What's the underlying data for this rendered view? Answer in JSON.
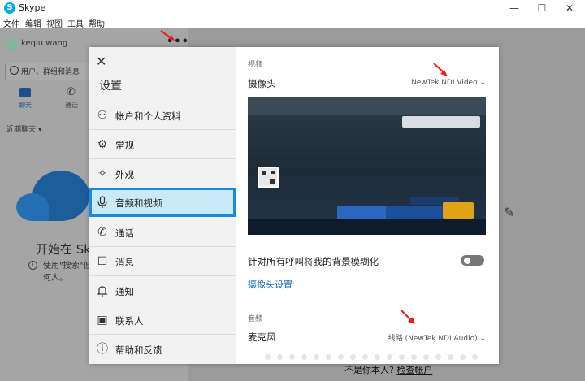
{
  "titlebar": {
    "app_name": "Skype",
    "logo_letter": "S",
    "minimize": "—",
    "maximize": "☐",
    "close": "✕"
  },
  "menubar": {
    "items": [
      "文件",
      "编辑",
      "视图",
      "工具",
      "帮助"
    ]
  },
  "sidebar": {
    "user_name": "keqiu wang",
    "more": "•••",
    "search_placeholder": "用户、群组和消息",
    "tabs": [
      {
        "label": "聊天"
      },
      {
        "label": "通话"
      }
    ],
    "recent_chats": "近期聊天 ▾",
    "start_text": "开始在 Sk",
    "hint_text": "使用\"搜索\"但 何人。"
  },
  "settings": {
    "title": "设置",
    "close": "✕",
    "nav_items": [
      {
        "label": "帐户和个人资料",
        "icon": "person-icon",
        "glyph": "⚇"
      },
      {
        "label": "常规",
        "icon": "gear-icon",
        "glyph": "⚙"
      },
      {
        "label": "外观",
        "icon": "magic-wand-icon",
        "glyph": "✧"
      },
      {
        "label": "音频和视频",
        "icon": "microphone-icon",
        "glyph": "🎙"
      },
      {
        "label": "通话",
        "icon": "phone-icon",
        "glyph": "✆"
      },
      {
        "label": "消息",
        "icon": "message-icon",
        "glyph": "☐"
      },
      {
        "label": "通知",
        "icon": "bell-icon",
        "glyph": "🔔"
      },
      {
        "label": "联系人",
        "icon": "contacts-icon",
        "glyph": "▣"
      },
      {
        "label": "帮助和反馈",
        "icon": "info-icon",
        "glyph": "ⓘ"
      }
    ],
    "active_index": 3
  },
  "audio_video": {
    "video_section": "视频",
    "camera_label": "摄像头",
    "camera_value": "NewTek NDI Video ⌄",
    "blur_label": "针对所有呼叫将我的背景模糊化",
    "blur_enabled": false,
    "camera_settings_link": "摄像头设置",
    "audio_section": "音频",
    "mic_label": "麦克风",
    "mic_value": "线路 (NewTek NDI Audio) ⌄"
  },
  "footer": {
    "not_you": "不是你本人?",
    "check_account": "检查帐户"
  },
  "colors": {
    "accent": "#1b8ad8",
    "link": "#1769c4",
    "annotation_arrow": "#e8201a"
  }
}
